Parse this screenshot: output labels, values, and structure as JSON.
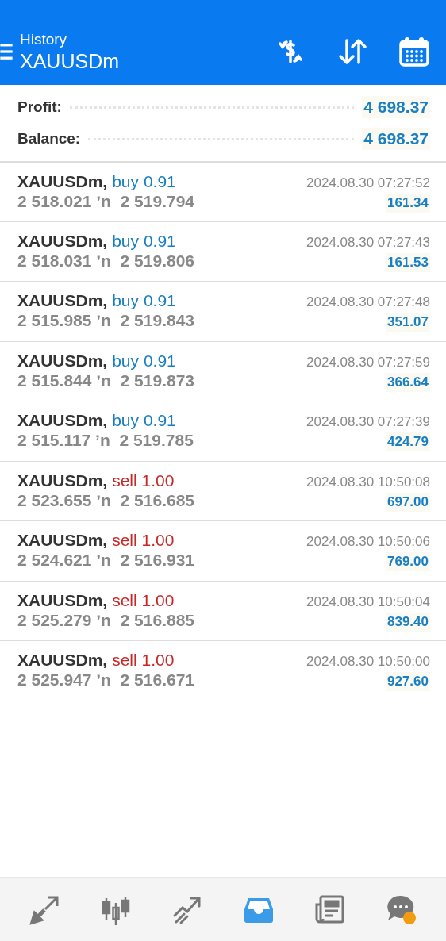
{
  "header": {
    "subtitle": "History",
    "title": "XAUUSDm"
  },
  "summary": [
    {
      "label": "Profit:",
      "value": "4 698.37"
    },
    {
      "label": "Balance:",
      "value": "4 698.37"
    }
  ],
  "deals": [
    {
      "symbol": "XAUUSDm,",
      "kind": "buy",
      "action": "buy 0.91",
      "prices": "2 518.021 ʼn  2 519.794",
      "time": "2024.08.30 07:27:52",
      "profit": "161.34"
    },
    {
      "symbol": "XAUUSDm,",
      "kind": "buy",
      "action": "buy 0.91",
      "prices": "2 518.031 ʼn  2 519.806",
      "time": "2024.08.30 07:27:43",
      "profit": "161.53"
    },
    {
      "symbol": "XAUUSDm,",
      "kind": "buy",
      "action": "buy 0.91",
      "prices": "2 515.985 ʼn  2 519.843",
      "time": "2024.08.30 07:27:48",
      "profit": "351.07"
    },
    {
      "symbol": "XAUUSDm,",
      "kind": "buy",
      "action": "buy 0.91",
      "prices": "2 515.844 ʼn  2 519.873",
      "time": "2024.08.30 07:27:59",
      "profit": "366.64"
    },
    {
      "symbol": "XAUUSDm,",
      "kind": "buy",
      "action": "buy 0.91",
      "prices": "2 515.117 ʼn  2 519.785",
      "time": "2024.08.30 07:27:39",
      "profit": "424.79"
    },
    {
      "symbol": "XAUUSDm,",
      "kind": "sell",
      "action": "sell 1.00",
      "prices": "2 523.655 ʼn  2 516.685",
      "time": "2024.08.30 10:50:08",
      "profit": "697.00"
    },
    {
      "symbol": "XAUUSDm,",
      "kind": "sell",
      "action": "sell 1.00",
      "prices": "2 524.621 ʼn  2 516.931",
      "time": "2024.08.30 10:50:06",
      "profit": "769.00"
    },
    {
      "symbol": "XAUUSDm,",
      "kind": "sell",
      "action": "sell 1.00",
      "prices": "2 525.279 ʼn  2 516.885",
      "time": "2024.08.30 10:50:04",
      "profit": "839.40"
    },
    {
      "symbol": "XAUUSDm,",
      "kind": "sell",
      "action": "sell 1.00",
      "prices": "2 525.947 ʼn  2 516.671",
      "time": "2024.08.30 10:50:00",
      "profit": "927.60"
    }
  ],
  "nav": [
    {
      "kind": "trade",
      "selected": false
    },
    {
      "kind": "quotes",
      "selected": false
    },
    {
      "kind": "chart",
      "selected": false
    },
    {
      "kind": "history",
      "selected": true
    },
    {
      "kind": "news",
      "selected": false
    },
    {
      "kind": "chat",
      "selected": false,
      "badge": true
    }
  ]
}
